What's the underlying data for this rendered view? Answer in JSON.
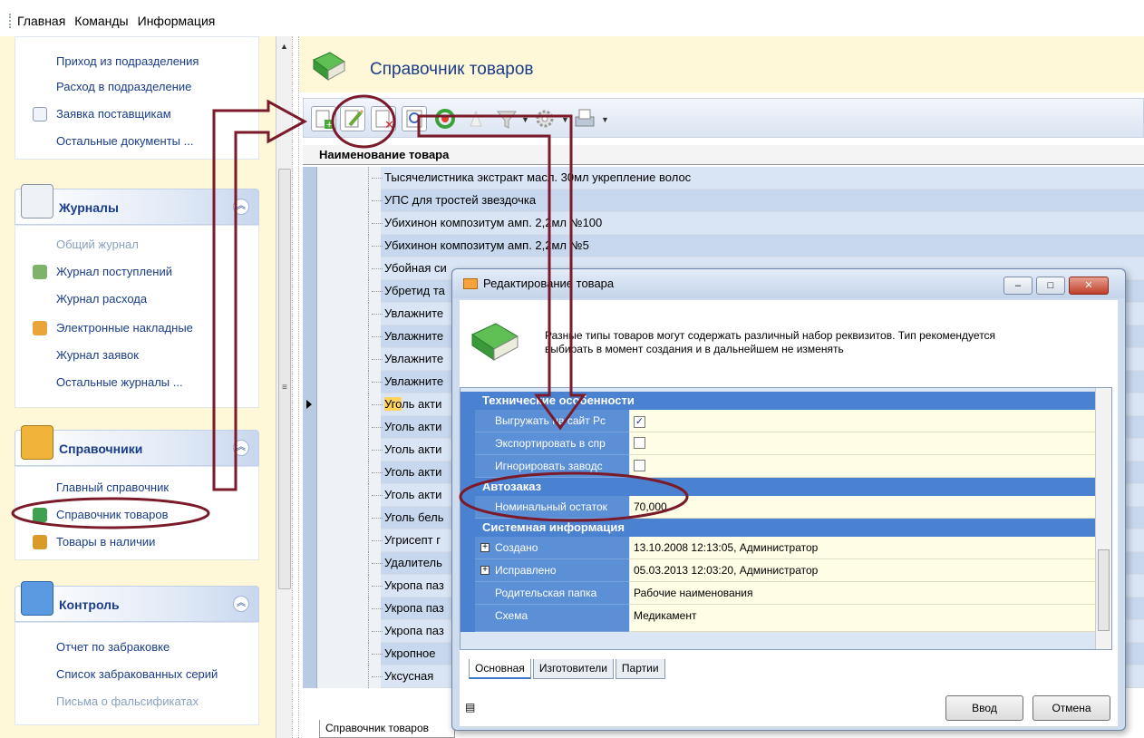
{
  "menubar": {
    "items": [
      "Главная",
      "Команды",
      "Информация"
    ]
  },
  "sidebar": {
    "top_items": [
      "Приход из подразделения",
      "Расход в подразделение",
      "Заявка поставщикам",
      "Остальные документы ..."
    ],
    "journals": {
      "title": "Журналы",
      "items": [
        "Общий журнал",
        "Журнал поступлений",
        "Журнал расхода",
        "Электронные накладные",
        "Журнал заявок",
        "Остальные журналы ..."
      ]
    },
    "directories": {
      "title": "Справочники",
      "items": [
        "Главный справочник",
        "Справочник товаров",
        "Товары в наличии"
      ]
    },
    "control": {
      "title": "Контроль",
      "items": [
        "Отчет по забраковке",
        "Список забракованных серий",
        "Письма о фальсификатах"
      ]
    }
  },
  "main": {
    "title": "Справочник товаров",
    "column_header": "Наименование товара",
    "rows": [
      "Тысячелистника экстракт масл. 30мл укрепление волос",
      "УПС для тростей звездочка",
      "Убихинон композитум амп. 2,2мл №100",
      "Убихинон композитум амп. 2,2мл №5",
      "Убойная си",
      "Убретид та",
      "Увлажните",
      "Увлажните",
      "Увлажните",
      "Увлажните",
      "Уголь акти",
      "Уголь акти",
      "Уголь акти",
      "Уголь акти",
      "Уголь акти",
      "Уголь бель",
      "Угрисепт г",
      "Удалитель",
      "Укропа паз",
      "Укропа паз",
      "Укропа паз",
      "Укропное",
      "Уксусная"
    ],
    "highlight_prefix": "Уго",
    "bottom_tab": "Справочник товаров"
  },
  "dialog": {
    "title": "Редактирование товара",
    "message_line1": "Разные типы товаров могут содержать различный набор реквизитов. Тип рекомендуется",
    "message_line2": "выбирать в момент создания и в дальнейшем не изменять",
    "categories": {
      "tech": "Технические особенности",
      "autoorder": "Автозаказ",
      "system": "Системная информация"
    },
    "props": {
      "upload": {
        "name": "Выгружать на сайт Рс",
        "checked": true
      },
      "export": {
        "name": "Экспортировать в спр",
        "checked": false
      },
      "ignore": {
        "name": "Игнорировать заводс",
        "checked": false
      },
      "nominal": {
        "name": "Номинальный остаток",
        "value": "70,000"
      },
      "created": {
        "name": "Создано",
        "value": "13.10.2008 12:13:05, Администратор"
      },
      "fixed": {
        "name": "Исправлено",
        "value": "05.03.2013 12:03:20, Администратор"
      },
      "parent": {
        "name": "Родительская папка",
        "value": "Рабочие наименования"
      },
      "scheme": {
        "name": "Схема",
        "value": "Медикамент"
      }
    },
    "tabs": [
      "Основная",
      "Изготовители",
      "Партии"
    ],
    "ok_label": "Ввод",
    "cancel_label": "Отмена",
    "window_buttons": [
      "–",
      "□",
      "✕"
    ]
  },
  "colors": {
    "annotation": "#7a1a2a",
    "accent": "#4a82d1"
  }
}
